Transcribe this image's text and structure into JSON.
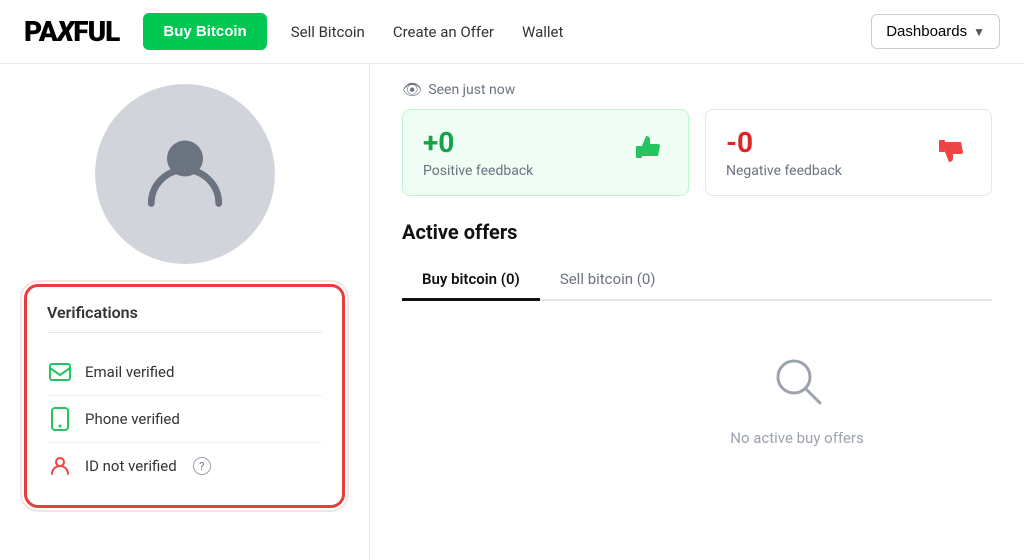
{
  "header": {
    "logo": "PAXFUL",
    "buy_bitcoin_label": "Buy Bitcoin",
    "nav": {
      "sell_bitcoin": "Sell Bitcoin",
      "create_offer": "Create an Offer",
      "wallet": "Wallet",
      "dashboards": "Dashboards"
    }
  },
  "profile": {
    "seen_label": "Seen just now",
    "feedback": {
      "positive_number": "+0",
      "positive_label": "Positive feedback",
      "negative_number": "-0",
      "negative_label": "Negative feedback"
    }
  },
  "verifications": {
    "title": "Verifications",
    "items": [
      {
        "label": "Email verified",
        "status": "verified",
        "type": "email"
      },
      {
        "label": "Phone verified",
        "status": "verified",
        "type": "phone"
      },
      {
        "label": "ID not verified",
        "status": "unverified",
        "type": "id"
      }
    ]
  },
  "active_offers": {
    "title": "Active offers",
    "tabs": [
      {
        "label": "Buy bitcoin (0)",
        "active": true
      },
      {
        "label": "Sell bitcoin (0)",
        "active": false
      }
    ],
    "empty_state": {
      "text": "No active buy offers"
    }
  }
}
